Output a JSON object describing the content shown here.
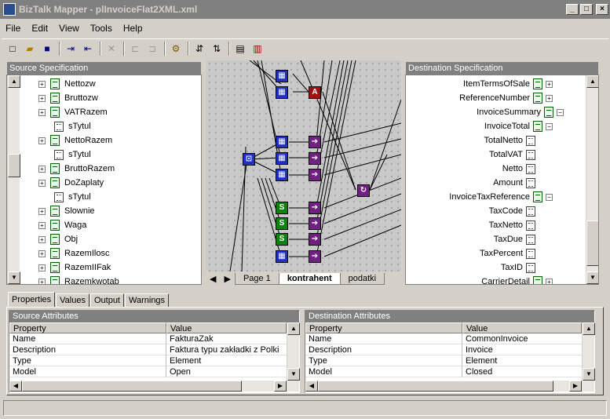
{
  "window": {
    "title": "BizTalk Mapper - plInvoiceFlat2XML.xml",
    "minimize_label": "_",
    "maximize_label": "□",
    "close_label": "×"
  },
  "menu": [
    "File",
    "Edit",
    "View",
    "Tools",
    "Help"
  ],
  "toolbar": {
    "icons": [
      "new-icon",
      "open-icon",
      "save-icon",
      "import-icon",
      "export-icon",
      "delete-icon",
      "link-icon",
      "unlink-icon",
      "compile-icon",
      "test-icon",
      "validate-icon",
      "add-record-icon",
      "remove-record-icon"
    ]
  },
  "source": {
    "header": "Source Specification",
    "items": [
      {
        "label": "Nettozw",
        "kind": "record",
        "level": 0
      },
      {
        "label": "Bruttozw",
        "kind": "record",
        "level": 0
      },
      {
        "label": "VATRazem",
        "kind": "record",
        "level": 0
      },
      {
        "label": "sTytul",
        "kind": "field",
        "level": 1
      },
      {
        "label": "NettoRazem",
        "kind": "record",
        "level": 0
      },
      {
        "label": "sTytul",
        "kind": "field",
        "level": 1
      },
      {
        "label": "BruttoRazem",
        "kind": "record",
        "level": 0
      },
      {
        "label": "DoZaplaty",
        "kind": "record",
        "level": 0
      },
      {
        "label": "sTytul",
        "kind": "field",
        "level": 1
      },
      {
        "label": "Slownie",
        "kind": "record",
        "level": 0
      },
      {
        "label": "Waga",
        "kind": "record",
        "level": 0
      },
      {
        "label": "Obj",
        "kind": "record",
        "level": 0
      },
      {
        "label": "RazemIlosc",
        "kind": "record",
        "level": 0
      },
      {
        "label": "RazemIIFak",
        "kind": "record",
        "level": 0
      },
      {
        "label": "Razemkwotab",
        "kind": "record",
        "level": 0
      }
    ]
  },
  "destination": {
    "header": "Destination Specification",
    "items": [
      {
        "label": "ItemTermsOfSale",
        "kind": "record"
      },
      {
        "label": "ReferenceNumber",
        "kind": "record"
      },
      {
        "label": "InvoiceSummary",
        "kind": "record"
      },
      {
        "label": "InvoiceTotal",
        "kind": "record"
      },
      {
        "label": "TotalNetto",
        "kind": "field"
      },
      {
        "label": "TotalVAT",
        "kind": "field"
      },
      {
        "label": "Netto",
        "kind": "field"
      },
      {
        "label": "Amount",
        "kind": "field"
      },
      {
        "label": "InvoiceTaxReference",
        "kind": "record"
      },
      {
        "label": "TaxCode",
        "kind": "field"
      },
      {
        "label": "TaxNetto",
        "kind": "field"
      },
      {
        "label": "TaxDue",
        "kind": "field"
      },
      {
        "label": "TaxPercent",
        "kind": "field"
      },
      {
        "label": "TaxID",
        "kind": "field"
      },
      {
        "label": "CarrierDetail",
        "kind": "record"
      }
    ]
  },
  "grid": {
    "pages": [
      "Page 1",
      "kontrahent",
      "podatki"
    ],
    "active_page": "kontrahent",
    "functoid_labels": {
      "string_concat": "A",
      "string": "S"
    }
  },
  "bottom_tabs": [
    "Properties",
    "Values",
    "Output",
    "Warnings"
  ],
  "source_attributes": {
    "header": "Source Attributes",
    "col_property": "Property",
    "col_value": "Value",
    "rows": [
      {
        "property": "Name",
        "value": "FakturaZak"
      },
      {
        "property": "Description",
        "value": "Faktura typu zakładki z Polki"
      },
      {
        "property": "Type",
        "value": "Element"
      },
      {
        "property": "Model",
        "value": "Open"
      }
    ]
  },
  "destination_attributes": {
    "header": "Destination Attributes",
    "col_property": "Property",
    "col_value": "Value",
    "rows": [
      {
        "property": "Name",
        "value": "CommonInvoice"
      },
      {
        "property": "Description",
        "value": "Invoice"
      },
      {
        "property": "Type",
        "value": "Element"
      },
      {
        "property": "Model",
        "value": "Closed"
      }
    ]
  }
}
